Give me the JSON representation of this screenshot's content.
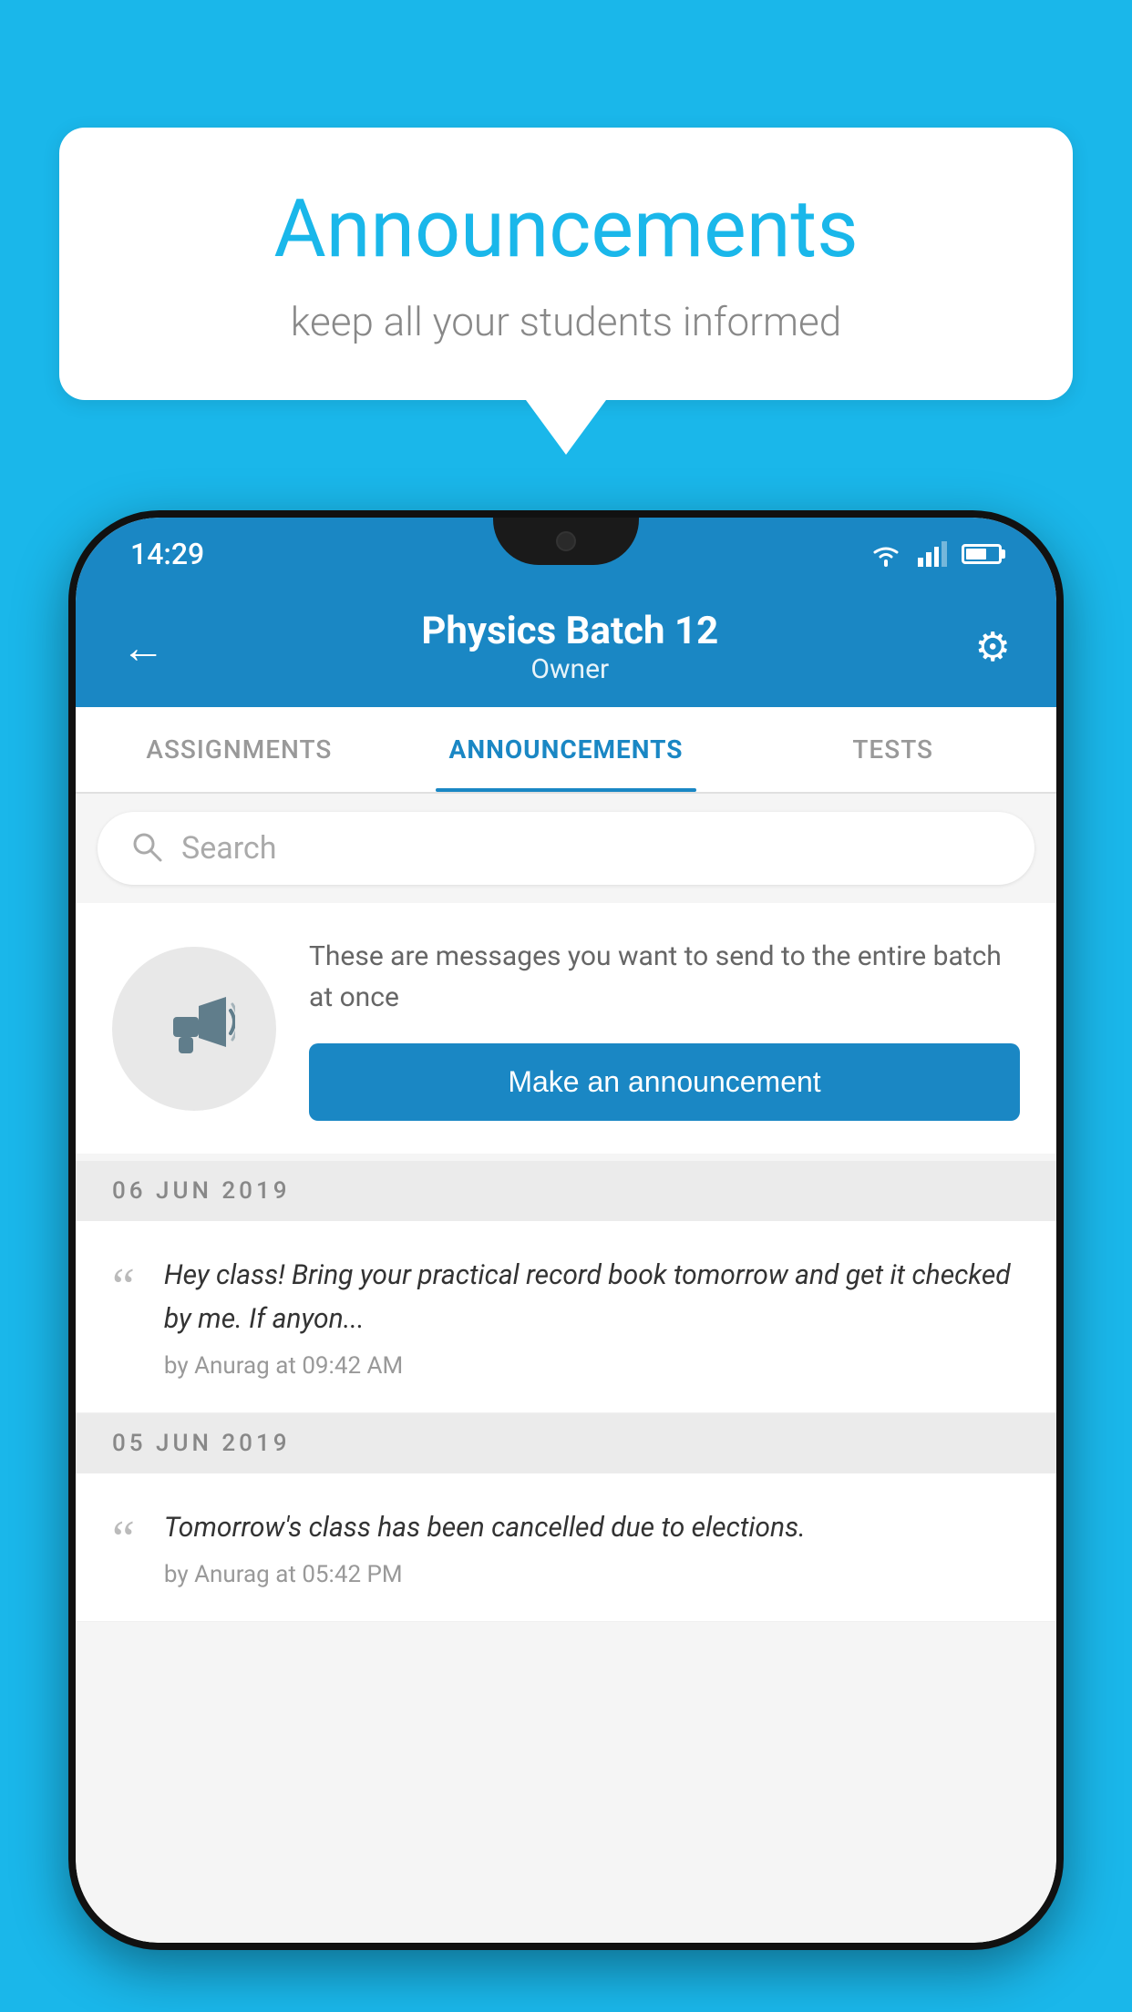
{
  "background_color": "#1ab7ea",
  "speech_bubble": {
    "title": "Announcements",
    "subtitle": "keep all your students informed"
  },
  "phone": {
    "status_bar": {
      "time": "14:29"
    },
    "header": {
      "title": "Physics Batch 12",
      "subtitle": "Owner",
      "back_label": "←",
      "settings_label": "⚙"
    },
    "tabs": [
      {
        "label": "ASSIGNMENTS",
        "active": false
      },
      {
        "label": "ANNOUNCEMENTS",
        "active": true
      },
      {
        "label": "TESTS",
        "active": false
      }
    ],
    "search": {
      "placeholder": "Search"
    },
    "announcement_prompt": {
      "description": "These are messages you want to send to the entire batch at once",
      "button_label": "Make an announcement"
    },
    "announcements": [
      {
        "date": "06  JUN  2019",
        "items": [
          {
            "text": "Hey class! Bring your practical record book tomorrow and get it checked by me. If anyon...",
            "by": "by Anurag at 09:42 AM"
          }
        ]
      },
      {
        "date": "05  JUN  2019",
        "items": [
          {
            "text": "Tomorrow's class has been cancelled due to elections.",
            "by": "by Anurag at 05:42 PM"
          }
        ]
      }
    ]
  }
}
